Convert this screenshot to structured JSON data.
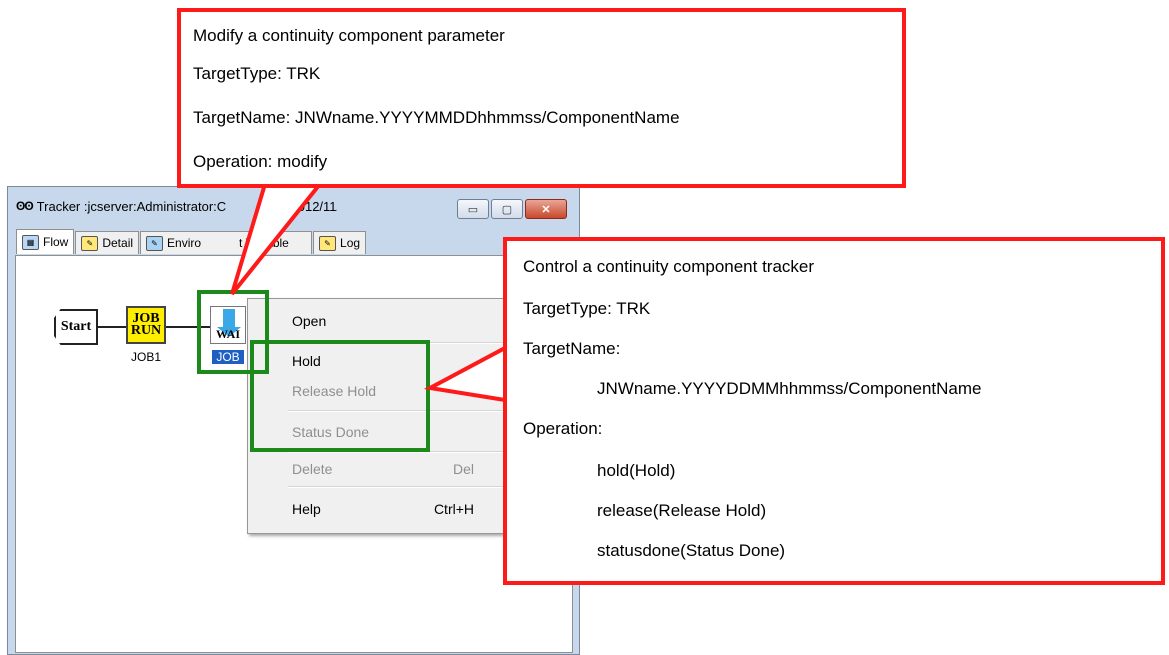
{
  "window": {
    "title": "Tracker :jcserver:Administrator:C",
    "title_tail": "(2012/11/2...",
    "app_icon": "eyes-icon",
    "buttons": {
      "minimize": "▭",
      "maximize": "▢",
      "close": "✕"
    }
  },
  "tabs": [
    {
      "label": "Flow",
      "icon": "flow-icon"
    },
    {
      "label": "Detail",
      "icon": "notebook-icon"
    },
    {
      "label": "Enviro",
      "icon": "notebook-icon"
    },
    {
      "label": "t Variable",
      "icon": ""
    },
    {
      "label": "Log",
      "icon": "notebook-icon"
    }
  ],
  "flow": {
    "start_label": "Start",
    "job_icon_line1": "JOB",
    "job_icon_line2": "RUN",
    "job_name": "JOB1",
    "wait_icon_text": "WAI",
    "wait_name": "JOB"
  },
  "context_menu": {
    "items": [
      {
        "label": "Open",
        "shortcut": "",
        "enabled": true
      },
      {
        "label": "Hold",
        "shortcut": "",
        "enabled": true
      },
      {
        "label": "Release Hold",
        "shortcut": "",
        "enabled": false
      },
      {
        "label": "Status Done",
        "shortcut": "",
        "enabled": false
      },
      {
        "label": "Delete",
        "shortcut": "Del",
        "enabled": false
      },
      {
        "label": "Help",
        "shortcut": "Ctrl+H",
        "enabled": true
      }
    ]
  },
  "callout_top": {
    "lines": [
      "Modify a continuity component parameter",
      "TargetType: TRK",
      "TargetName: JNWname.YYYYMMDDhhmmss/ComponentName",
      "Operation: modify"
    ]
  },
  "callout_right": {
    "lines": [
      "Control a continuity component tracker",
      "TargetType: TRK",
      "TargetName:",
      "JNWname.YYYYDDMMhhmmss/ComponentName",
      "Operation:",
      "hold(Hold)",
      "release(Release Hold)",
      "statusdone(Status Done)"
    ]
  },
  "colors": {
    "callout_border": "#ff1a1a",
    "highlight_border": "#1b8a1b",
    "selection": "#1f5fc1"
  }
}
